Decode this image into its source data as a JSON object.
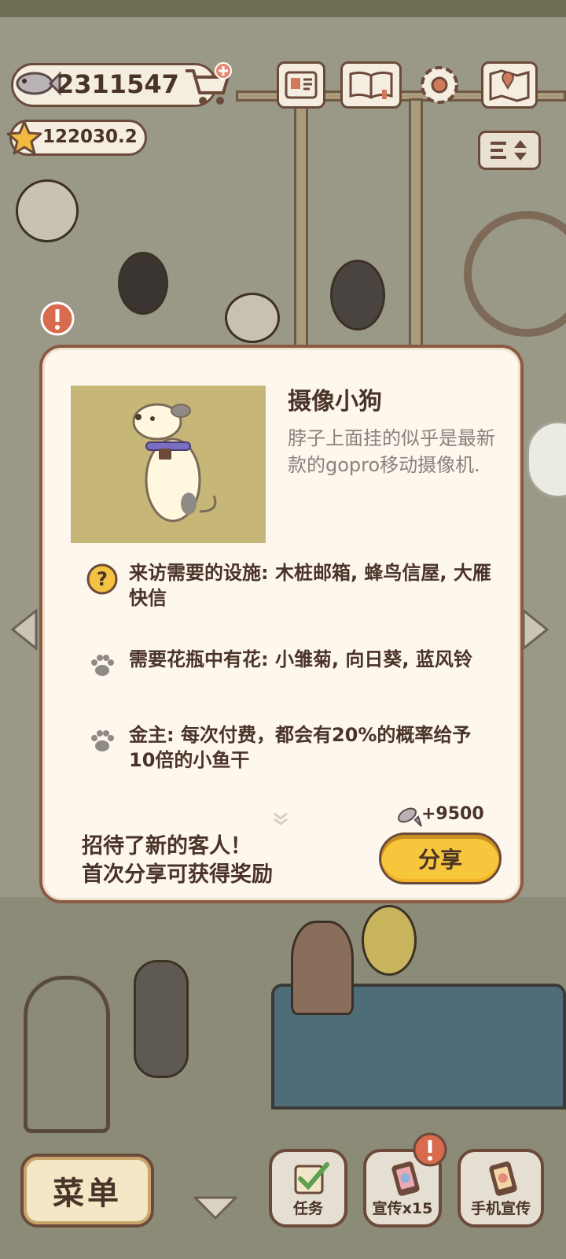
{
  "hud": {
    "fish_count": "2311547",
    "star_count": "122030.2"
  },
  "modal": {
    "character_name": "摄像小狗",
    "character_description": "脖子上面挂的似乎是最新款的gopro移动摄像机.",
    "requirements": [
      {
        "icon": "question-icon",
        "text": "来访需要的设施: 木桩邮箱, 蜂鸟信屋, 大雁快信"
      },
      {
        "icon": "paw-icon",
        "text": "需要花瓶中有花: 小雏菊, 向日葵, 蓝风铃"
      },
      {
        "icon": "paw-icon",
        "text": "金主: 每次付费，都会有20%的概率给予10倍的小鱼干"
      }
    ],
    "reward_value": "+9500",
    "share_message_line1": "招待了新的客人！",
    "share_message_line2": "首次分享可获得奖励",
    "share_label": "分享"
  },
  "bottom_bar": {
    "menu_label": "菜单",
    "tasks_label": "任务",
    "promote_label": "宣传x15",
    "phone_promote_label": "手机宣传"
  },
  "colors": {
    "accent_yellow": "#f8c63d",
    "panel_bg": "#fdf7ee",
    "border_brown": "#6b4a3a"
  }
}
